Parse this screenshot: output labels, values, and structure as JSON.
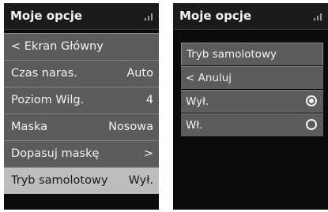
{
  "left_screen": {
    "title": "Moje opcje",
    "back_label": "< Ekran Główny",
    "items": [
      {
        "label": "Czas naras.",
        "value": "Auto"
      },
      {
        "label": "Poziom Wilg.",
        "value": "4"
      },
      {
        "label": "Maska",
        "value": "Nosowa"
      },
      {
        "label": "Dopasuj maskę",
        "value": ">"
      }
    ],
    "highlight": {
      "label": "Tryb samolotowy",
      "value": "Wył."
    }
  },
  "right_screen": {
    "title": "Moje opcje",
    "submenu_title": "Tryb samolotowy",
    "cancel_label": "< Anuluj",
    "options": [
      {
        "label": "Wył.",
        "selected": true
      },
      {
        "label": "Wł.",
        "selected": false
      }
    ]
  },
  "icons": [
    "signal-icon",
    "radio-checked-icon",
    "radio-unchecked-icon"
  ],
  "colors": {
    "screen_bg": "#0b0b0b",
    "row_bg": "#5c5c5c",
    "highlight_bg": "#bdbdbd"
  }
}
